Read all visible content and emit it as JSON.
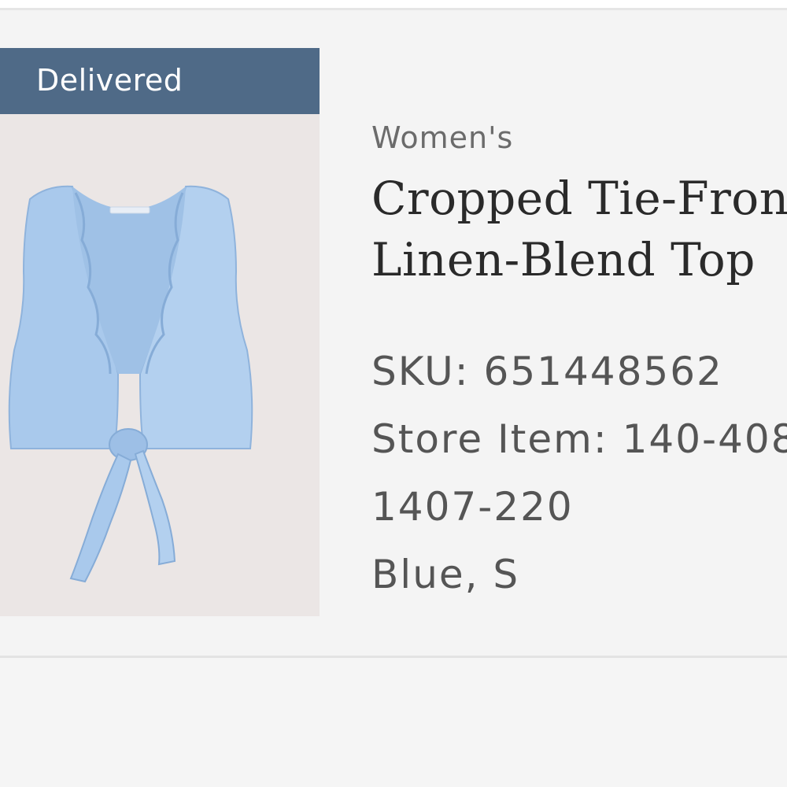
{
  "order_item": {
    "status": "Delivered",
    "category": "Women's",
    "title_line1": "Cropped Tie-Front",
    "title_line2": "Linen-Blend Top",
    "sku_label": "SKU: 651448562",
    "store_item_label": "Store Item: 140-408",
    "style_code": "1407-220",
    "variant": "Blue, S"
  },
  "colors": {
    "status_banner": "#4f6a87",
    "product_color": "#a9c9ec",
    "image_background": "#ebe6e5"
  },
  "icons": {
    "product_image": "sleeveless-tie-front-top"
  }
}
